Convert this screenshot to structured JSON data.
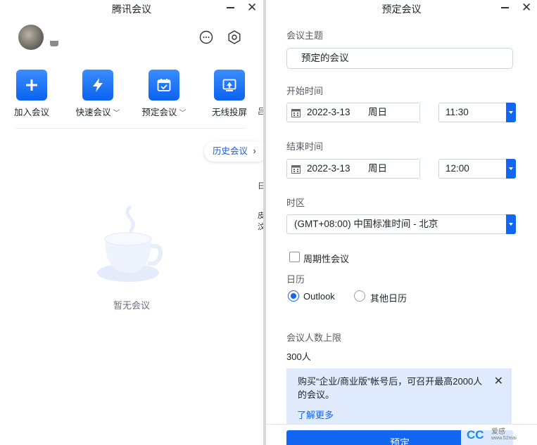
{
  "left_window": {
    "title": "腾讯会议",
    "actions": [
      {
        "label": "加入会议",
        "icon": "plus-icon",
        "dropdown": false
      },
      {
        "label": "快速会议",
        "icon": "lightning-icon",
        "dropdown": true
      },
      {
        "label": "预定会议",
        "icon": "calendar-icon",
        "dropdown": true
      },
      {
        "label": "无线投屏",
        "icon": "screen-cast-icon",
        "dropdown": false
      }
    ],
    "history_button": "历史会议",
    "empty_text": "暂无会议",
    "stray_chars": [
      "吕",
      "日",
      "皮",
      "汶"
    ]
  },
  "right_window": {
    "title": "预定会议",
    "topic": {
      "label": "会议主题",
      "value": "预定的会议"
    },
    "start": {
      "label": "开始时间",
      "date": "2022-3-13",
      "weekday": "周日",
      "time": "11:30"
    },
    "end": {
      "label": "结束时间",
      "date": "2022-3-13",
      "weekday": "周日",
      "time": "12:00"
    },
    "timezone": {
      "label": "时区",
      "value": "(GMT+08:00) 中国标准时间 - 北京"
    },
    "recurring": {
      "label": "周期性会议",
      "checked": false
    },
    "calendar": {
      "label": "日历",
      "options": [
        "Outlook",
        "其他日历"
      ],
      "selected": "Outlook"
    },
    "capacity": {
      "label": "会议人数上限",
      "value": "300人"
    },
    "notice": {
      "text": "购买“企业/商业版”帐号后，可召开最高2000人的会议。",
      "link": "了解更多"
    },
    "submit": "预定"
  },
  "watermark": {
    "logo": "CC",
    "cn": "爱感",
    "url": "www.52mai"
  },
  "colors": {
    "accent": "#1266f1",
    "notice_bg": "#dfeafc",
    "muted_text": "#6a7280"
  }
}
